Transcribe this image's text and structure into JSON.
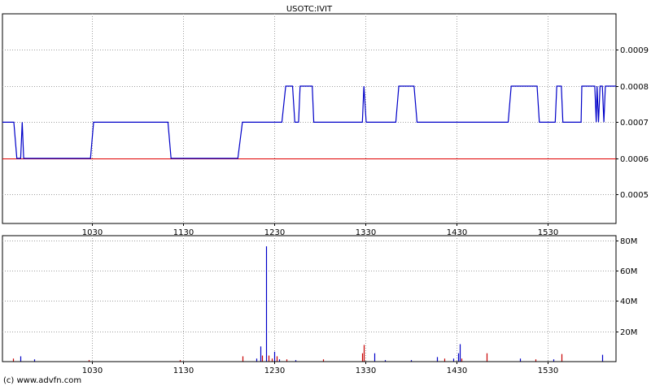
{
  "chart_data": [
    {
      "type": "line",
      "title": "USOTC:IVIT",
      "xlabel": "",
      "ylabel": "",
      "x_ticks": [
        "1030",
        "1130",
        "1230",
        "1330",
        "1430",
        "1530"
      ],
      "x_tick_minutes": [
        630,
        690,
        750,
        810,
        870,
        930
      ],
      "xlim_minutes": [
        571,
        975
      ],
      "ylim": [
        0.00042,
        0.001
      ],
      "y_ticks": [
        0.0005,
        0.0006,
        0.0007,
        0.0008,
        0.0009
      ],
      "y_tick_labels": [
        "0.0005",
        "0.0006",
        "0.0007",
        "0.0008",
        "0.0009"
      ],
      "grid": true,
      "reference_line": {
        "value": 0.0006,
        "color": "#e00000"
      },
      "series": [
        {
          "color": "#0000c8",
          "points": [
            [
              571,
              0.0007
            ],
            [
              578.5,
              0.0007
            ],
            [
              580.5,
              0.0006
            ],
            [
              583,
              0.0006
            ],
            [
              584,
              0.0007
            ],
            [
              585,
              0.0006
            ],
            [
              629,
              0.0006
            ],
            [
              631,
              0.0007
            ],
            [
              680,
              0.0007
            ],
            [
              682,
              0.0006
            ],
            [
              726,
              0.0006
            ],
            [
              729,
              0.0007
            ],
            [
              755,
              0.0007
            ],
            [
              757.5,
              0.0008
            ],
            [
              762,
              0.0008
            ],
            [
              763.5,
              0.0007
            ],
            [
              766,
              0.0007
            ],
            [
              767,
              0.0008
            ],
            [
              775,
              0.0008
            ],
            [
              776,
              0.0007
            ],
            [
              808,
              0.0007
            ],
            [
              809,
              0.0008
            ],
            [
              810.5,
              0.0007
            ],
            [
              830,
              0.0007
            ],
            [
              832,
              0.0008
            ],
            [
              842,
              0.0008
            ],
            [
              844,
              0.0007
            ],
            [
              904,
              0.0007
            ],
            [
              906,
              0.0008
            ],
            [
              923,
              0.0008
            ],
            [
              924.5,
              0.0007
            ],
            [
              935,
              0.0007
            ],
            [
              936,
              0.0008
            ],
            [
              939,
              0.0008
            ],
            [
              940,
              0.0007
            ],
            [
              952,
              0.0007
            ],
            [
              952.5,
              0.0008
            ],
            [
              961,
              0.0008
            ],
            [
              962,
              0.0007
            ],
            [
              962.5,
              0.0008
            ],
            [
              963.5,
              0.0007
            ],
            [
              964.5,
              0.0008
            ],
            [
              966,
              0.0008
            ],
            [
              967,
              0.0007
            ],
            [
              968,
              0.0008
            ],
            [
              975,
              0.0008
            ]
          ]
        }
      ]
    },
    {
      "type": "bar",
      "xlabel": "",
      "ylabel": "",
      "x_ticks": [
        "1030",
        "1130",
        "1230",
        "1330",
        "1430",
        "1530"
      ],
      "x_tick_minutes": [
        630,
        690,
        750,
        810,
        870,
        930
      ],
      "xlim_minutes": [
        571,
        975
      ],
      "ylim": [
        0,
        83000000
      ],
      "y_ticks": [
        20000000,
        40000000,
        60000000,
        80000000
      ],
      "y_tick_labels": [
        "20M",
        "40M",
        "60M",
        "80M"
      ],
      "grid": true,
      "colors": {
        "up": "#0000c8",
        "down": "#c80000"
      },
      "bars": [
        {
          "t": 578,
          "v": 2000000,
          "c": "down"
        },
        {
          "t": 583,
          "v": 3500000,
          "c": "up"
        },
        {
          "t": 592,
          "v": 1500000,
          "c": "up"
        },
        {
          "t": 628,
          "v": 1000000,
          "c": "down"
        },
        {
          "t": 688,
          "v": 1000000,
          "c": "down"
        },
        {
          "t": 729,
          "v": 3500000,
          "c": "down"
        },
        {
          "t": 738,
          "v": 2000000,
          "c": "up"
        },
        {
          "t": 741,
          "v": 10000000,
          "c": "up"
        },
        {
          "t": 742,
          "v": 4000000,
          "c": "down"
        },
        {
          "t": 744.5,
          "v": 76000000,
          "c": "up"
        },
        {
          "t": 746,
          "v": 4000000,
          "c": "down"
        },
        {
          "t": 748.5,
          "v": 2000000,
          "c": "down"
        },
        {
          "t": 750,
          "v": 6500000,
          "c": "up"
        },
        {
          "t": 751.5,
          "v": 3500000,
          "c": "down"
        },
        {
          "t": 753,
          "v": 1500000,
          "c": "up"
        },
        {
          "t": 758,
          "v": 1500000,
          "c": "down"
        },
        {
          "t": 764,
          "v": 1000000,
          "c": "up"
        },
        {
          "t": 782,
          "v": 1500000,
          "c": "down"
        },
        {
          "t": 808,
          "v": 5500000,
          "c": "down"
        },
        {
          "t": 809,
          "v": 11000000,
          "c": "down"
        },
        {
          "t": 816,
          "v": 5500000,
          "c": "up"
        },
        {
          "t": 823,
          "v": 1000000,
          "c": "up"
        },
        {
          "t": 840,
          "v": 1000000,
          "c": "up"
        },
        {
          "t": 857,
          "v": 3000000,
          "c": "up"
        },
        {
          "t": 862,
          "v": 2000000,
          "c": "down"
        },
        {
          "t": 868,
          "v": 2000000,
          "c": "up"
        },
        {
          "t": 871,
          "v": 5500000,
          "c": "up"
        },
        {
          "t": 872,
          "v": 11500000,
          "c": "up"
        },
        {
          "t": 873,
          "v": 2000000,
          "c": "down"
        },
        {
          "t": 890,
          "v": 5500000,
          "c": "down"
        },
        {
          "t": 912,
          "v": 2000000,
          "c": "up"
        },
        {
          "t": 922,
          "v": 1500000,
          "c": "down"
        },
        {
          "t": 934,
          "v": 1500000,
          "c": "up"
        },
        {
          "t": 939,
          "v": 5000000,
          "c": "down"
        },
        {
          "t": 966,
          "v": 4500000,
          "c": "up"
        }
      ]
    }
  ],
  "credit": "(c) www.advfn.com"
}
